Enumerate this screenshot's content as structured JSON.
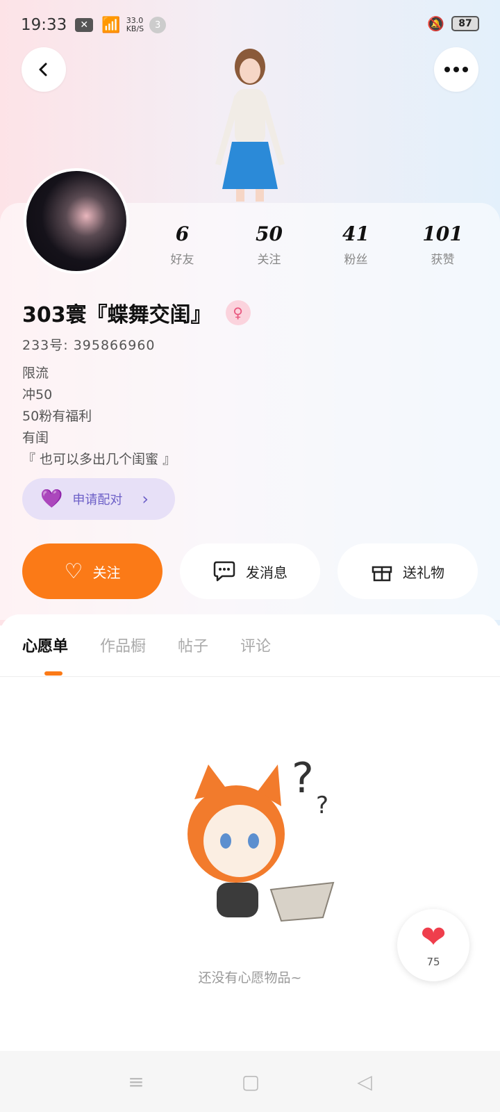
{
  "status_bar": {
    "time": "19:33",
    "speed_value": "33.0",
    "speed_unit": "KB/S",
    "notif_count": "3",
    "battery": "87"
  },
  "header": {
    "back_icon": "back-arrow-icon",
    "more_icon": "more-dots-icon"
  },
  "stats": [
    {
      "value": "6",
      "label": "好友"
    },
    {
      "value": "50",
      "label": "关注"
    },
    {
      "value": "41",
      "label": "粉丝"
    },
    {
      "value": "101",
      "label": "获赞"
    }
  ],
  "profile": {
    "name": "303寰『蝶舞交闺』",
    "gender_symbol": "♀",
    "uid": "233号: 395866960",
    "bio": [
      "限流",
      "冲50",
      "50粉有福利",
      "有闺",
      "『 也可以多出几个闺蜜 』"
    ],
    "pair_button": "申请配对"
  },
  "actions": {
    "follow": "关注",
    "message": "发消息",
    "gift": "送礼物"
  },
  "tabs": [
    "心愿单",
    "作品橱",
    "帖子",
    "评论"
  ],
  "active_tab": "心愿单",
  "empty_state": "还没有心愿物品~",
  "like": {
    "count": "75"
  },
  "colors": {
    "accent": "#fb7a17",
    "pair_bg": "#e7e0f7",
    "like_heart": "#ef3e4c"
  }
}
